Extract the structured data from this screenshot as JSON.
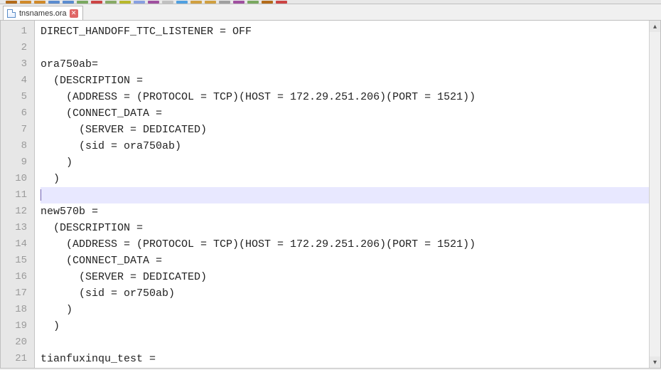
{
  "tab": {
    "filename": "tnsnames.ora",
    "close_glyph": "✕"
  },
  "scrollbar": {
    "up": "▴",
    "down": "▾"
  },
  "code": {
    "lines": [
      "DIRECT_HANDOFF_TTC_LISTENER = OFF",
      "",
      "ora750ab=",
      "  (DESCRIPTION =",
      "    (ADDRESS = (PROTOCOL = TCP)(HOST = 172.29.251.206)(PORT = 1521))",
      "    (CONNECT_DATA =",
      "      (SERVER = DEDICATED)",
      "      (sid = ora750ab)",
      "    )",
      "  )",
      "",
      "new570b =",
      "  (DESCRIPTION =",
      "    (ADDRESS = (PROTOCOL = TCP)(HOST = 172.29.251.206)(PORT = 1521))",
      "    (CONNECT_DATA =",
      "      (SERVER = DEDICATED)",
      "      (sid = or750ab)",
      "    )",
      "  )",
      "",
      "tianfuxinqu_test ="
    ],
    "current_line_index": 10
  },
  "toolbar_colors": [
    "#b36b19",
    "#d08a2a",
    "#d08a2a",
    "#5b8ccf",
    "#5b8ccf",
    "#7aa860",
    "#c44",
    "#8a6",
    "#b8b82a",
    "#88a0e0",
    "#a050a0",
    "#c0c0c0",
    "#50a0e0",
    "#d0a040",
    "#d0a040",
    "#a0a0a0",
    "#a050a0",
    "#7aa860",
    "#b36b19",
    "#c44"
  ]
}
